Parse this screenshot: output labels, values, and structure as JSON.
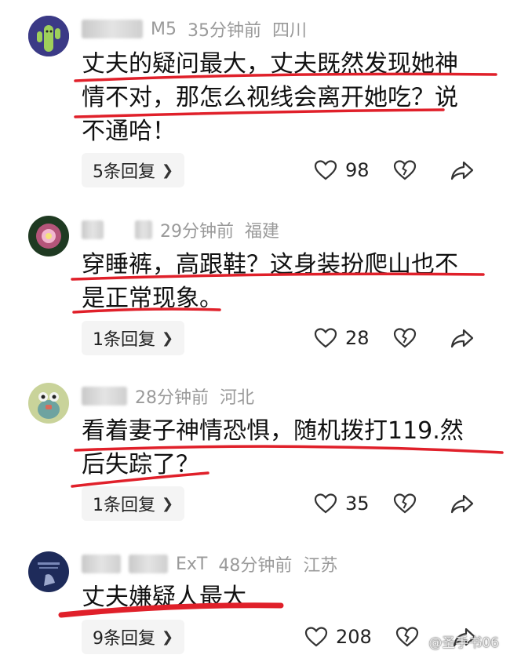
{
  "comments": [
    {
      "name_visible": "M5",
      "time": "35分钟前",
      "location": "四川",
      "lines": [
        "丈夫的疑问最大，丈夫既然发现她神",
        "情不对，那怎么视线会离开她吃？说",
        "不通哈！"
      ],
      "replies": "5条回复",
      "likes": "98"
    },
    {
      "name_visible": "",
      "time": "29分钟前",
      "location": "福建",
      "lines": [
        "穿睡裤，高跟鞋？这身装扮爬山也不",
        "是正常现象。"
      ],
      "replies": "1条回复",
      "likes": "28"
    },
    {
      "name_visible": "",
      "time": "28分钟前",
      "location": "河北",
      "lines": [
        "看着妻子神情恐惧，随机拨打119.然",
        "后失踪了？"
      ],
      "replies": "1条回复",
      "likes": "35"
    },
    {
      "name_visible": "ExT",
      "time": "48分钟前",
      "location": "江苏",
      "lines": [
        "丈夫嫌疑人最大"
      ],
      "replies": "9条回复",
      "likes": "208"
    }
  ],
  "colors": {
    "annotation_red": "#e0202a",
    "meta_gray": "#9a9a9a"
  },
  "icons": [
    "heart-icon",
    "broken-heart-icon",
    "share-arrow-icon",
    "chevron-right-icon"
  ],
  "watermark": "@圣手书06"
}
